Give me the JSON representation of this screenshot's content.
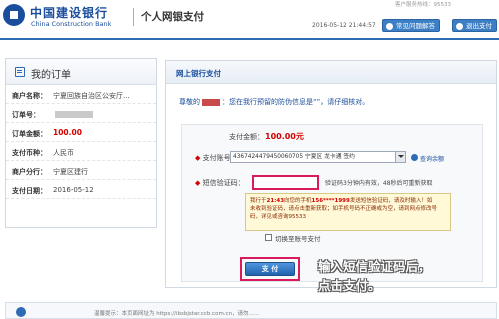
{
  "header": {
    "bank_name_cn": "中国建设银行",
    "bank_name_en": "China Construction Bank",
    "system_title": "个人网银支付",
    "timestamp": "2016-05-12 21:44:57",
    "top_faint_text": "客户服务热线：95533",
    "faq_button": "常见问题解答",
    "exit_button": "退出支付",
    "logo_icon": "ccb-logo-icon"
  },
  "order": {
    "title": "我的订单",
    "rows": [
      {
        "key": "商户名称：",
        "value": "宁夏回族自治区公安厅..."
      },
      {
        "key": "订单号：",
        "value": "——"
      },
      {
        "key": "订单金额：",
        "value": "100.00"
      },
      {
        "key": "支付币种：",
        "value": "人民币"
      },
      {
        "key": "商户分行：",
        "value": "宁夏区建行"
      },
      {
        "key": "支付日期：",
        "value": "2016-05-12"
      }
    ]
  },
  "panel": {
    "title": "网上银行支付",
    "greeting_prefix": "尊敬的",
    "greeting_suffix": "：您在我行预留的防伪信息是“”，请仔细核对。",
    "amount_label": "支付金额：",
    "amount_value": "100.00元",
    "account_label": "支付账号：",
    "account_value": "4367424479450060705 宁夏区 龙卡通 签约",
    "query_balance": "查询余额",
    "sms_label": "短信验证码：",
    "sms_value": "",
    "sms_hint": "验证码3分钟内有效，48秒后可重新获取",
    "tip_line1_a": "我行于",
    "tip_line1_b": "21:43",
    "tip_line1_c": "向您的手机",
    "tip_line1_d": "156****1999",
    "tip_line1_e": "发送短信验证码，请及时输入！如",
    "tip_line2": "未收到验证码，请点击重新获取；如手机号码不正确或为空，请到网点修改号",
    "tip_line3": "码，详见或咨询95533",
    "switch_account": "切换至账号支付",
    "pay_button": "支 付"
  },
  "annotation": {
    "line1": "输入短信验证码后，",
    "line2": "点击支付。"
  },
  "footer": {
    "text": "温馨提示：本页面网址为 https://ibsbjstar.ccb.com.cn，请勿……"
  },
  "colors": {
    "brand_blue": "#1a4e9c",
    "highlight_pink": "#d91b5c",
    "amount_red": "#d40000"
  }
}
